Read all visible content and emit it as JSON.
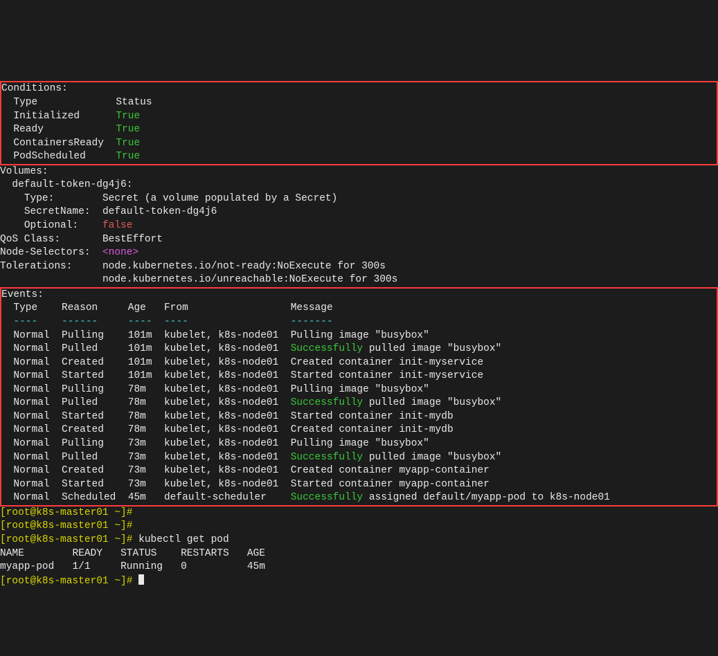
{
  "conditions": {
    "header": "Conditions:",
    "col1": "Type",
    "col2": "Status",
    "rows": [
      {
        "type": "Initialized",
        "status": "True"
      },
      {
        "type": "Ready",
        "status": "True"
      },
      {
        "type": "ContainersReady",
        "status": "True"
      },
      {
        "type": "PodScheduled",
        "status": "True"
      }
    ]
  },
  "volumes": {
    "header": "Volumes:",
    "name": "default-token-dg4j6:",
    "typeLabel": "Type:",
    "typeValue": "Secret (a volume populated by a Secret)",
    "secretLabel": "SecretName:",
    "secretValue": "default-token-dg4j6",
    "optionalLabel": "Optional:",
    "optionalValue": "false"
  },
  "qos": {
    "label": "QoS Class:",
    "value": "BestEffort"
  },
  "nsel": {
    "label": "Node-Selectors:",
    "value": "<none>"
  },
  "tol": {
    "label": "Tolerations:",
    "v1": "node.kubernetes.io/not-ready:NoExecute for 300s",
    "v2": "node.kubernetes.io/unreachable:NoExecute for 300s"
  },
  "events": {
    "header": "Events:",
    "cols": {
      "type": "Type",
      "reason": "Reason",
      "age": "Age",
      "from": "From",
      "message": "Message"
    },
    "dashes": {
      "type": "----",
      "reason": "------",
      "age": "----",
      "from": "----",
      "message": "-------"
    },
    "rows": [
      {
        "t": "Normal",
        "r": "Pulling",
        "a": "101m",
        "f": "kubelet, k8s-node01",
        "mBefore": "Pulling image \"busybox\"",
        "ok": "",
        "mAfter": ""
      },
      {
        "t": "Normal",
        "r": "Pulled",
        "a": "101m",
        "f": "kubelet, k8s-node01",
        "mBefore": "",
        "ok": "Successfully",
        "mAfter": " pulled image \"busybox\""
      },
      {
        "t": "Normal",
        "r": "Created",
        "a": "101m",
        "f": "kubelet, k8s-node01",
        "mBefore": "Created container init-myservice",
        "ok": "",
        "mAfter": ""
      },
      {
        "t": "Normal",
        "r": "Started",
        "a": "101m",
        "f": "kubelet, k8s-node01",
        "mBefore": "Started container init-myservice",
        "ok": "",
        "mAfter": ""
      },
      {
        "t": "Normal",
        "r": "Pulling",
        "a": "78m",
        "f": "kubelet, k8s-node01",
        "mBefore": "Pulling image \"busybox\"",
        "ok": "",
        "mAfter": ""
      },
      {
        "t": "Normal",
        "r": "Pulled",
        "a": "78m",
        "f": "kubelet, k8s-node01",
        "mBefore": "",
        "ok": "Successfully",
        "mAfter": " pulled image \"busybox\""
      },
      {
        "t": "Normal",
        "r": "Started",
        "a": "78m",
        "f": "kubelet, k8s-node01",
        "mBefore": "Started container init-mydb",
        "ok": "",
        "mAfter": ""
      },
      {
        "t": "Normal",
        "r": "Created",
        "a": "78m",
        "f": "kubelet, k8s-node01",
        "mBefore": "Created container init-mydb",
        "ok": "",
        "mAfter": ""
      },
      {
        "t": "Normal",
        "r": "Pulling",
        "a": "73m",
        "f": "kubelet, k8s-node01",
        "mBefore": "Pulling image \"busybox\"",
        "ok": "",
        "mAfter": ""
      },
      {
        "t": "Normal",
        "r": "Pulled",
        "a": "73m",
        "f": "kubelet, k8s-node01",
        "mBefore": "",
        "ok": "Successfully",
        "mAfter": " pulled image \"busybox\""
      },
      {
        "t": "Normal",
        "r": "Created",
        "a": "73m",
        "f": "kubelet, k8s-node01",
        "mBefore": "Created container myapp-container",
        "ok": "",
        "mAfter": ""
      },
      {
        "t": "Normal",
        "r": "Started",
        "a": "73m",
        "f": "kubelet, k8s-node01",
        "mBefore": "Started container myapp-container",
        "ok": "",
        "mAfter": ""
      },
      {
        "t": "Normal",
        "r": "Scheduled",
        "a": "45m",
        "f": "default-scheduler",
        "mBefore": "",
        "ok": "Successfully",
        "mAfter": " assigned default/myapp-pod to k8s-node01"
      }
    ]
  },
  "prompt": {
    "user": "root@k8s-master01",
    "path": "~",
    "hash": "#",
    "l": "[",
    "r": "]",
    "cmd": "kubectl get pod"
  },
  "podlist": {
    "h": {
      "name": "NAME",
      "ready": "READY",
      "status": "STATUS",
      "restarts": "RESTARTS",
      "age": "AGE"
    },
    "row": {
      "name": "myapp-pod",
      "ready": "1/1",
      "status": "Running",
      "restarts": "0",
      "age": "45m"
    }
  }
}
